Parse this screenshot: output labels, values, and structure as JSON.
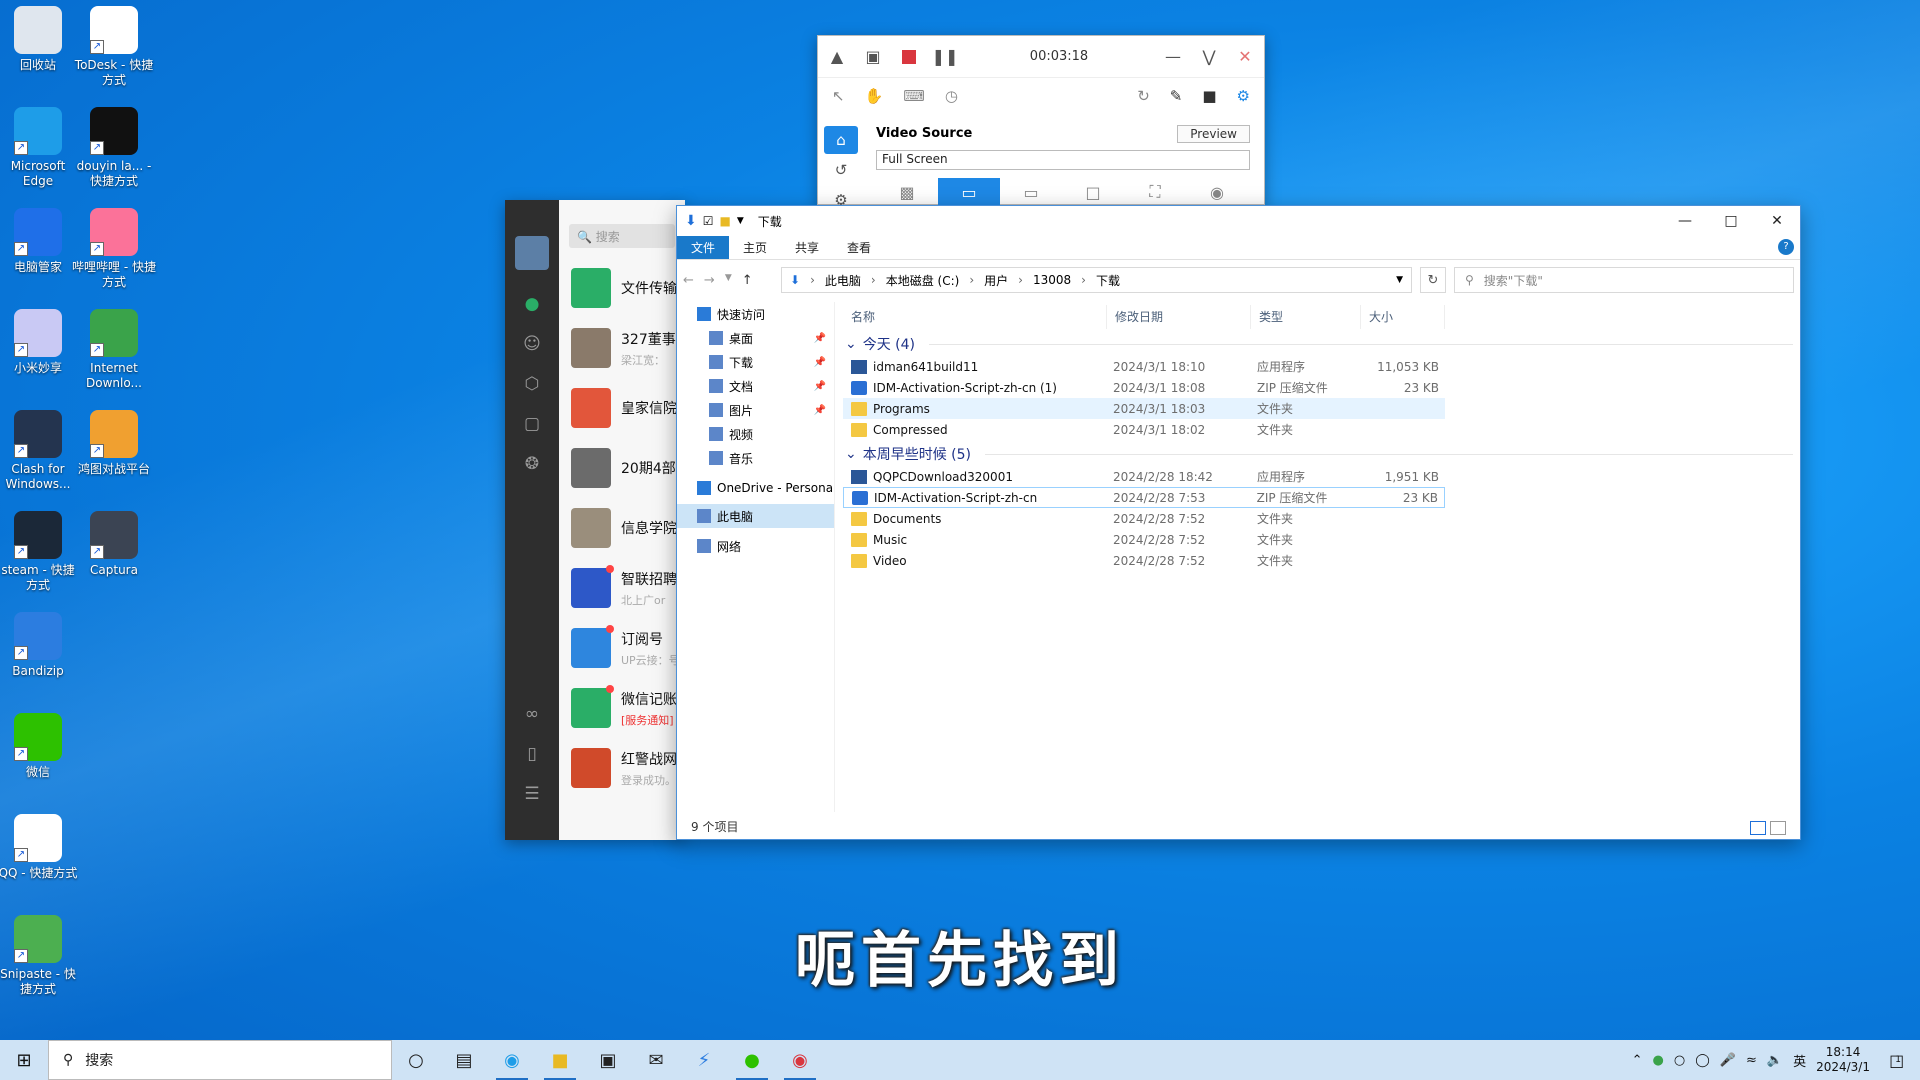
{
  "desktop": {
    "icons": [
      {
        "label": "回收站",
        "color": "#dfe6ee"
      },
      {
        "label": "ToDesk - 快捷方式",
        "color": "#ffffff"
      },
      {
        "label": "Microsoft Edge",
        "color": "#1e9de8"
      },
      {
        "label": "douyin la... - 快捷方式",
        "color": "#111111"
      },
      {
        "label": "电脑管家",
        "color": "#1f6fe8"
      },
      {
        "label": "哔哩哔哩 - 快捷方式",
        "color": "#fb7299"
      },
      {
        "label": "小米妙享",
        "color": "#c9c9f4"
      },
      {
        "label": "Internet Downlo...",
        "color": "#3aa34a"
      },
      {
        "label": "Clash for Windows...",
        "color": "#24344f"
      },
      {
        "label": "鸿图对战平台",
        "color": "#f0a030"
      },
      {
        "label": "steam - 快捷方式",
        "color": "#1b2838"
      },
      {
        "label": "Captura",
        "color": "#3b4453"
      },
      {
        "label": "Bandizip",
        "color": "#2c7de0"
      },
      {
        "label": "微信",
        "color": "#2dc100"
      },
      {
        "label": "QQ - 快捷方式",
        "color": "#ffffff"
      },
      {
        "label": "Snipaste - 快捷方式",
        "color": "#4caf50"
      }
    ]
  },
  "recorder": {
    "timer": "00:03:18",
    "video_source_label": "Video Source",
    "preview_label": "Preview",
    "source_value": "Full Screen"
  },
  "wechat": {
    "search_placeholder": "搜索",
    "chats": [
      {
        "name": "文件传输",
        "preview": "",
        "color": "#2aae67",
        "unread": false,
        "red": false
      },
      {
        "name": "327董事",
        "preview": "梁江宽：",
        "color": "#8a7a6a",
        "unread": false,
        "red": false
      },
      {
        "name": "皇家信院",
        "preview": "",
        "color": "#e2563b",
        "unread": false,
        "red": false
      },
      {
        "name": "20期4部",
        "preview": "",
        "color": "#6b6b6b",
        "unread": false,
        "red": false
      },
      {
        "name": "信息学院",
        "preview": "",
        "color": "#9a8e7c",
        "unread": false,
        "red": false
      },
      {
        "name": "智联招聘",
        "preview": "北上广or",
        "color": "#2d58c8",
        "unread": true,
        "red": false
      },
      {
        "name": "订阅号",
        "preview": "UP云接：号",
        "color": "#2e86de",
        "unread": true,
        "red": false
      },
      {
        "name": "微信记账",
        "preview": "[服务通知]",
        "color": "#2aae67",
        "unread": true,
        "red": true
      },
      {
        "name": "红警战网",
        "preview": "登录成功。",
        "color": "#d04a2a",
        "unread": false,
        "red": false
      }
    ]
  },
  "explorer": {
    "title": "下载",
    "ribbon_tabs": [
      "文件",
      "主页",
      "共享",
      "查看"
    ],
    "breadcrumb": [
      "此电脑",
      "本地磁盘 (C:)",
      "用户",
      "13008",
      "下载"
    ],
    "search_placeholder": "搜索\"下载\"",
    "nav_items": [
      {
        "label": "快速访问",
        "pinned": false,
        "indent": 1,
        "selected": false
      },
      {
        "label": "桌面",
        "pinned": true,
        "indent": 2,
        "selected": false
      },
      {
        "label": "下载",
        "pinned": true,
        "indent": 2,
        "selected": false
      },
      {
        "label": "文档",
        "pinned": true,
        "indent": 2,
        "selected": false
      },
      {
        "label": "图片",
        "pinned": true,
        "indent": 2,
        "selected": false
      },
      {
        "label": "视频",
        "pinned": false,
        "indent": 2,
        "selected": false
      },
      {
        "label": "音乐",
        "pinned": false,
        "indent": 2,
        "selected": false
      },
      {
        "label": "OneDrive - Persona",
        "pinned": false,
        "indent": 1,
        "selected": false
      },
      {
        "label": "此电脑",
        "pinned": false,
        "indent": 1,
        "selected": true
      },
      {
        "label": "网络",
        "pinned": false,
        "indent": 1,
        "selected": false
      }
    ],
    "columns": [
      "名称",
      "修改日期",
      "类型",
      "大小"
    ],
    "groups": [
      {
        "title": "今天 (4)",
        "files": [
          {
            "name": "idman641build11",
            "date": "2024/3/1 18:10",
            "type": "应用程序",
            "size": "11,053 KB",
            "icon": "app",
            "state": ""
          },
          {
            "name": "IDM-Activation-Script-zh-cn (1)",
            "date": "2024/3/1 18:08",
            "type": "ZIP 压缩文件",
            "size": "23 KB",
            "icon": "zip",
            "state": ""
          },
          {
            "name": "Programs",
            "date": "2024/3/1 18:03",
            "type": "文件夹",
            "size": "",
            "icon": "folder",
            "state": "hl"
          },
          {
            "name": "Compressed",
            "date": "2024/3/1 18:02",
            "type": "文件夹",
            "size": "",
            "icon": "folder",
            "state": ""
          }
        ]
      },
      {
        "title": "本周早些时候 (5)",
        "files": [
          {
            "name": "QQPCDownload320001",
            "date": "2024/2/28 18:42",
            "type": "应用程序",
            "size": "1,951 KB",
            "icon": "app",
            "state": ""
          },
          {
            "name": "IDM-Activation-Script-zh-cn",
            "date": "2024/2/28 7:53",
            "type": "ZIP 压缩文件",
            "size": "23 KB",
            "icon": "zip",
            "state": "sel"
          },
          {
            "name": "Documents",
            "date": "2024/2/28 7:52",
            "type": "文件夹",
            "size": "",
            "icon": "folder",
            "state": ""
          },
          {
            "name": "Music",
            "date": "2024/2/28 7:52",
            "type": "文件夹",
            "size": "",
            "icon": "folder",
            "state": ""
          },
          {
            "name": "Video",
            "date": "2024/2/28 7:52",
            "type": "文件夹",
            "size": "",
            "icon": "folder",
            "state": ""
          }
        ]
      }
    ],
    "status": "9 个项目"
  },
  "subtitle": "呃首先找到",
  "taskbar": {
    "search_placeholder": "搜索",
    "ime": "英",
    "time": "18:14",
    "date": "2024/3/1",
    "notifications": "1"
  }
}
